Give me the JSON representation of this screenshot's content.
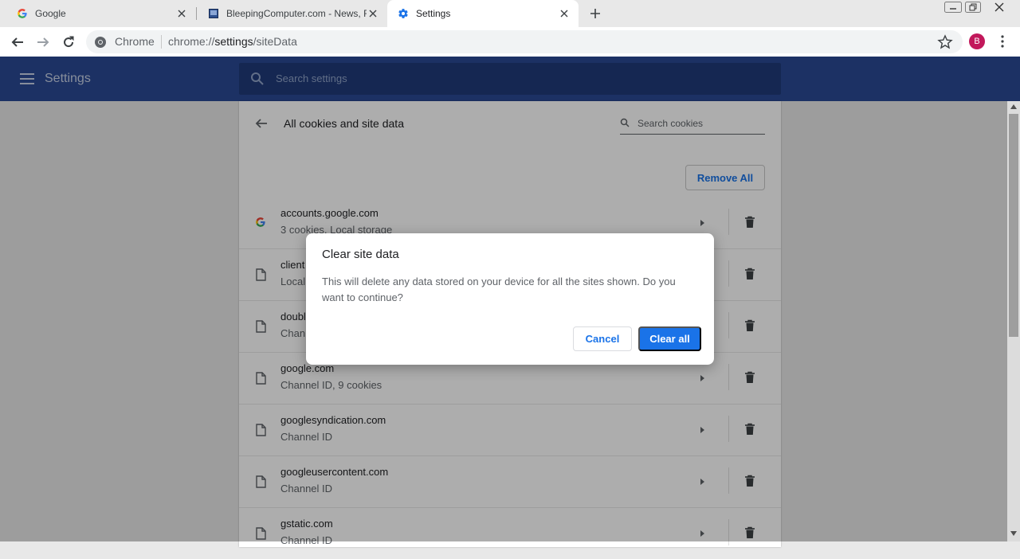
{
  "tabs": [
    {
      "title": "Google",
      "favicon": "google-g-icon"
    },
    {
      "title": "BleepingComputer.com - News, R",
      "favicon": "bleepingcomputer-icon"
    },
    {
      "title": "Settings",
      "favicon": "settings-gear-icon"
    }
  ],
  "active_tab": 2,
  "toolbar": {
    "omnibox_chip": "Chrome",
    "url_scheme": "chrome://",
    "url_host": "settings",
    "url_path": "/siteData",
    "avatar_letter": "B"
  },
  "header": {
    "title": "Settings",
    "search_placeholder": "Search settings"
  },
  "page": {
    "subpage_title": "All cookies and site data",
    "cookie_search_placeholder": "Search cookies",
    "remove_all_label": "Remove All"
  },
  "sites": [
    {
      "name": "accounts.google.com",
      "desc": "3 cookies, Local storage",
      "icon": "google-g-icon"
    },
    {
      "name": "client",
      "desc": "Local",
      "icon": "file-icon"
    },
    {
      "name": "doubl",
      "desc": "Chann",
      "icon": "file-icon"
    },
    {
      "name": "google.com",
      "desc": "Channel ID, 9 cookies",
      "icon": "file-icon"
    },
    {
      "name": "googlesyndication.com",
      "desc": "Channel ID",
      "icon": "file-icon"
    },
    {
      "name": "googleusercontent.com",
      "desc": "Channel ID",
      "icon": "file-icon"
    },
    {
      "name": "gstatic.com",
      "desc": "Channel ID",
      "icon": "file-icon"
    }
  ],
  "dialog": {
    "title": "Clear site data",
    "body": "This will delete any data stored on your device for all the sites shown. Do you want to continue?",
    "cancel_label": "Cancel",
    "confirm_label": "Clear all"
  },
  "colors": {
    "header_blue": "#2a4994",
    "accent_blue": "#1a73e8",
    "avatar_pink": "#c2185b"
  }
}
